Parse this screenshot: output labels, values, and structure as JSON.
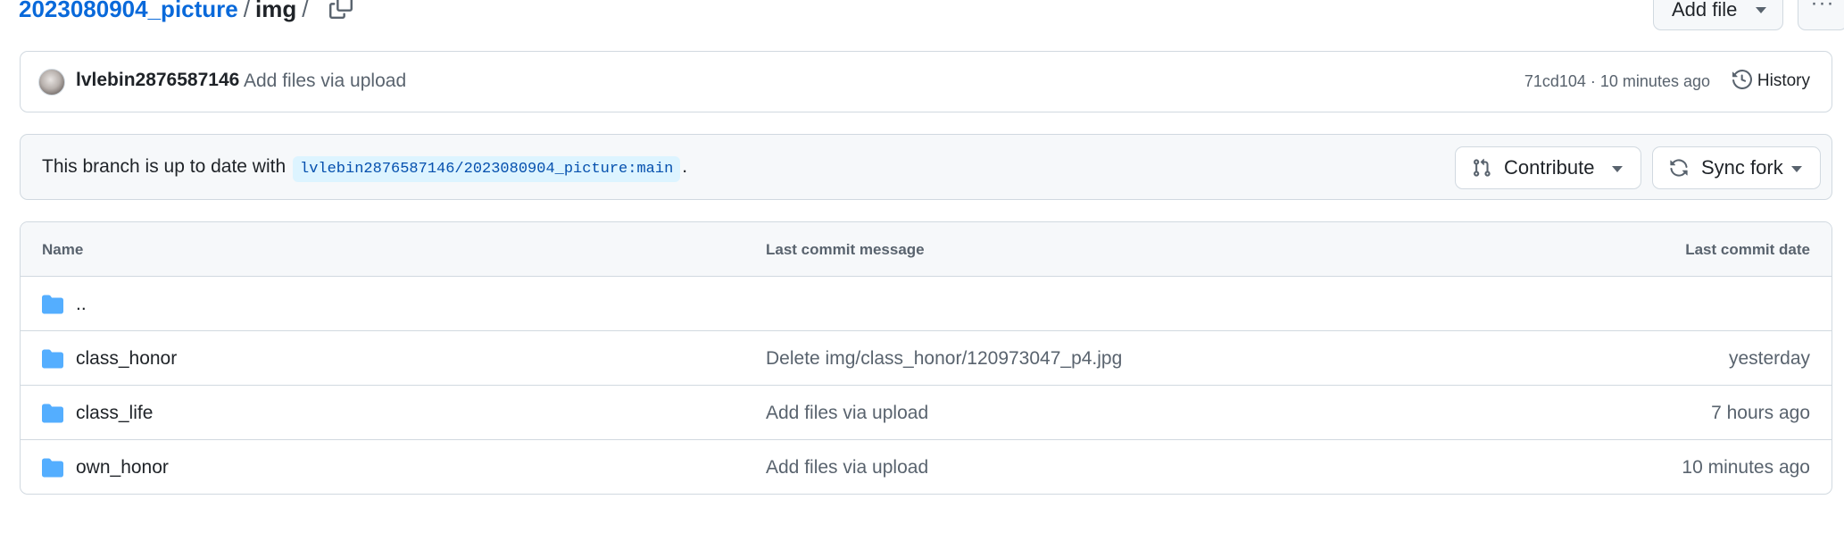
{
  "breadcrumb": {
    "repo": "2023080904_picture",
    "separator": "/",
    "current": "img",
    "trailing_separator": "/"
  },
  "toolbar": {
    "add_file_label": "Add file",
    "more_label": "···"
  },
  "latest_commit": {
    "author": "lvlebin2876587146",
    "message": "Add files via upload",
    "meta": "71cd104 · 10 minutes ago",
    "history_label": "History"
  },
  "fork_status": {
    "prefix": "This branch is up to date with",
    "branch": "lvlebin2876587146/2023080904_picture:main",
    "suffix": ".",
    "contribute_label": "Contribute",
    "sync_label": "Sync fork"
  },
  "file_table": {
    "headers": {
      "name": "Name",
      "message": "Last commit message",
      "date": "Last commit date"
    },
    "rows": [
      {
        "name": "..",
        "message": "",
        "date": ""
      },
      {
        "name": "class_honor",
        "message": "Delete img/class_honor/120973047_p4.jpg",
        "date": "yesterday"
      },
      {
        "name": "class_life",
        "message": "Add files via upload",
        "date": "7 hours ago"
      },
      {
        "name": "own_honor",
        "message": "Add files via upload",
        "date": "10 minutes ago"
      }
    ]
  },
  "colors": {
    "link": "#0969da",
    "folder": "#54aeff",
    "muted_text": "#59636e",
    "border": "#d1d9e0"
  },
  "icons": [
    "copy-icon",
    "history-icon",
    "git-pull-request-icon",
    "sync-icon",
    "folder-icon",
    "triangle-down-icon",
    "kebab-horizontal-icon"
  ]
}
